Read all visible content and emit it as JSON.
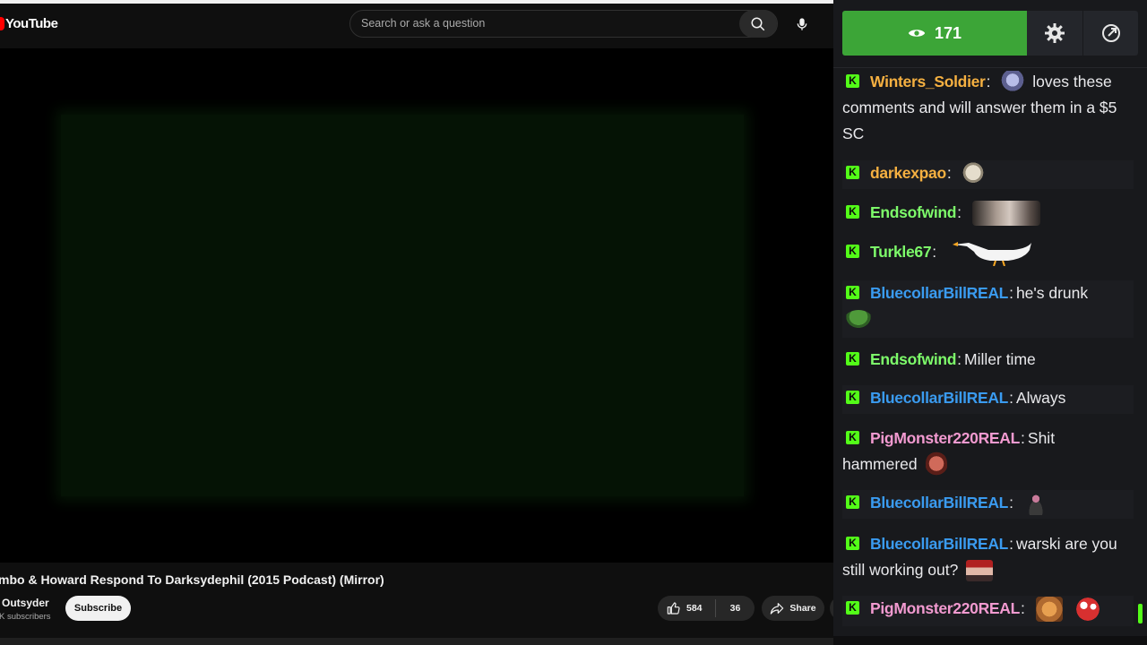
{
  "youtube": {
    "logo_text": "YouTube",
    "search_placeholder": "Search or ask a question",
    "video_title": "mbo & Howard Respond To Darksydephil (2015 Podcast) (Mirror)",
    "channel_name": "Outsyder",
    "subscriber_text": "K subscribers",
    "subscribe_label": "Subscribe",
    "like_count": "584",
    "dislike_count": "36",
    "share_label": "Share",
    "icons": [
      "search-icon",
      "microphone-icon",
      "thumbs-up-icon",
      "share-icon"
    ]
  },
  "chat": {
    "viewer_count": "171",
    "accent_color": "#53fc18",
    "viewer_box_color": "#3ca537",
    "icons": [
      "eye-icon",
      "gear-icon",
      "popout-icon"
    ],
    "messages": [
      {
        "user": "Winters_Soldier",
        "color": "#f5b041",
        "text": "loves these comments and will answer them in a $5 SC",
        "emotes": [
          "wolf-emote"
        ]
      },
      {
        "user": "darkexpao",
        "color": "#f5b041",
        "text": "",
        "emotes": [
          "skull-emote"
        ]
      },
      {
        "user": "Endsofwind",
        "color": "#7dfb6a",
        "text": "",
        "emotes": [
          "cat-emote"
        ]
      },
      {
        "user": "Turkle67",
        "color": "#7dfb6a",
        "text": "",
        "emotes": [
          "goose-emote"
        ]
      },
      {
        "user": "BluecollarBillREAL",
        "color": "#3a9bf0",
        "text": "he's drunk",
        "emotes": [
          "frog-emote"
        ]
      },
      {
        "user": "Endsofwind",
        "color": "#7dfb6a",
        "text": "Miller time",
        "emotes": []
      },
      {
        "user": "BluecollarBillREAL",
        "color": "#3a9bf0",
        "text": "Always",
        "emotes": []
      },
      {
        "user": "PigMonster220REAL",
        "color": "#f29ad0",
        "text": "Shit hammered",
        "emotes": [
          "face-emote"
        ]
      },
      {
        "user": "BluecollarBillREAL",
        "color": "#3a9bf0",
        "text": "",
        "emotes": [
          "figure-emote"
        ]
      },
      {
        "user": "BluecollarBillREAL",
        "color": "#3a9bf0",
        "text": "warski are you still working out?",
        "emotes": [
          "cap-face-emote"
        ]
      },
      {
        "user": "PigMonster220REAL",
        "color": "#f29ad0",
        "text": "",
        "emotes": [
          "cat-emote",
          "mushroom-emote"
        ]
      }
    ]
  }
}
